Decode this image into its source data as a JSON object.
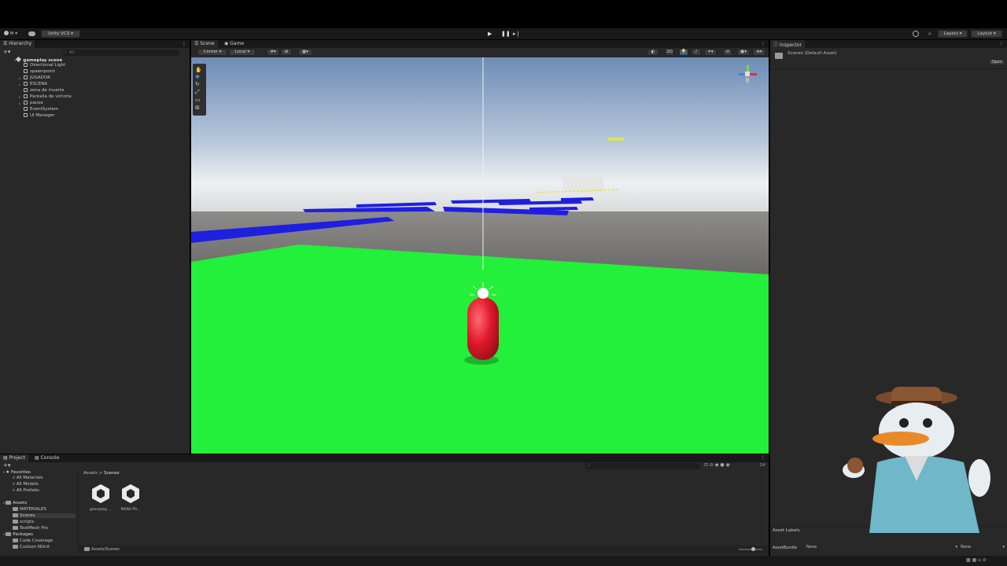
{
  "toolbar": {
    "account_label": "M",
    "vcs_label": "Unity VCS",
    "layers_label": "Layers",
    "layout_label": "Layout"
  },
  "hierarchy": {
    "tab_label": "Hierarchy",
    "search_placeholder": "All",
    "scene_name": "gameplay scene",
    "items": [
      {
        "label": "Directional Light",
        "expandable": false
      },
      {
        "label": "spawnpoint",
        "expandable": false
      },
      {
        "label": "JUGADOR",
        "expandable": true
      },
      {
        "label": "ESCENA",
        "expandable": true
      },
      {
        "label": "zona de muerte",
        "expandable": false
      },
      {
        "label": "Pantalla de victoria",
        "expandable": true
      },
      {
        "label": "pausa",
        "expandable": true
      },
      {
        "label": "EventSystem",
        "expandable": false
      },
      {
        "label": "UI Manager",
        "expandable": false
      }
    ]
  },
  "scene_view": {
    "tabs": [
      "Scene",
      "Game"
    ],
    "pivot_label": "Center",
    "space_label": "Local",
    "mode_2d_label": "2D",
    "gizmo_label": "< Persp"
  },
  "inspector": {
    "tab_label": "Inspector",
    "title": "Scenes (Default Asset)",
    "open_button": "Open",
    "asset_labels": "Asset Labels",
    "asset_bundle_label": "AssetBundle",
    "asset_bundle_value": "None",
    "asset_variant_value": "None"
  },
  "project": {
    "tabs": [
      "Project",
      "Console"
    ],
    "favorites_label": "Favorites",
    "favorites": [
      "All Materials",
      "All Models",
      "All Prefabs"
    ],
    "assets_label": "Assets",
    "asset_folders": [
      "MATERIALES",
      "Scenes",
      "scripts",
      "TextMesh Pro"
    ],
    "packages_label": "Packages",
    "packages": [
      "Code Coverage",
      "Custom NUnit"
    ],
    "breadcrumb": [
      "Assets",
      "Scenes"
    ],
    "files": [
      "gameplay ...",
      "MENU PR..."
    ],
    "status_path": "Assets/Scenes",
    "hidden_count": "14"
  },
  "colors": {
    "ground": "#22f03a",
    "platform": "#1f1fe0",
    "player": "#e0182a"
  }
}
